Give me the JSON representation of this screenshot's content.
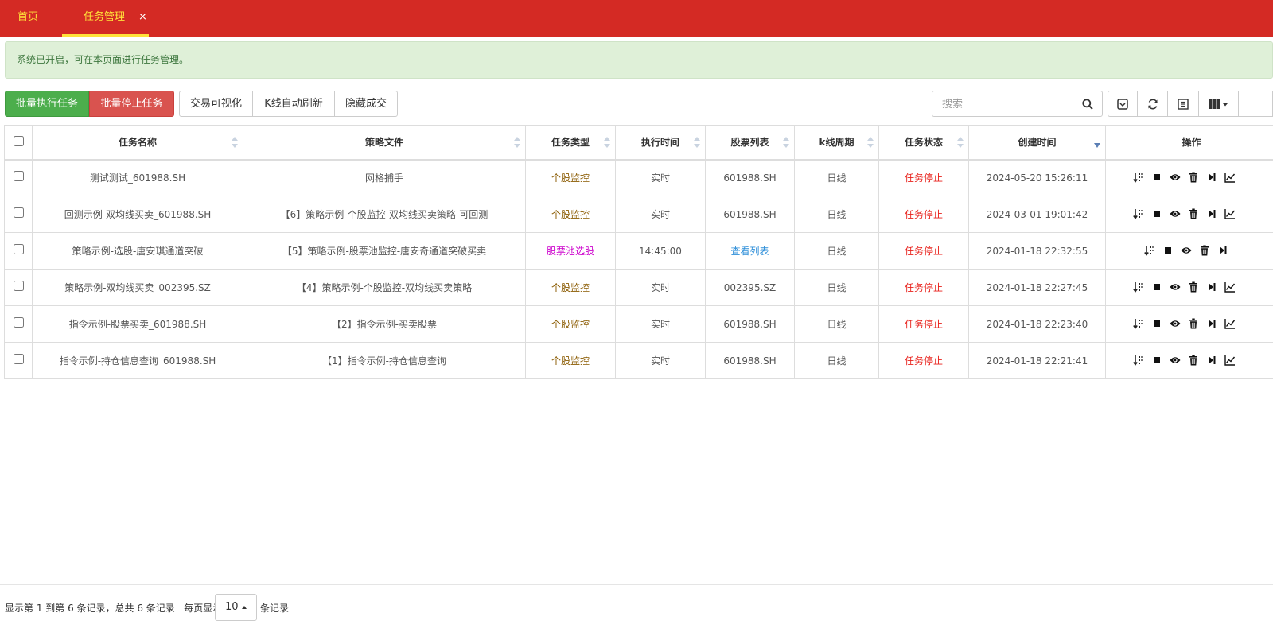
{
  "tabs": {
    "home": "首页",
    "active": "任务管理",
    "close": "×"
  },
  "alert": "系统已开启，可在本页面进行任务管理。",
  "toolbar": {
    "batch_run": "批量执行任务",
    "batch_stop": "批量停止任务",
    "trade_visual": "交易可视化",
    "kline_refresh": "K线自动刷新",
    "hide_deals": "隐藏成交",
    "search_placeholder": "搜索"
  },
  "table": {
    "headers": [
      "任务名称",
      "策略文件",
      "任务类型",
      "执行时间",
      "股票列表",
      "k线周期",
      "任务状态",
      "创建时间",
      "操作"
    ],
    "rows": [
      {
        "name": "测试测试_601988.SH",
        "strategy": "网格捕手",
        "type": "个股监控",
        "time": "实时",
        "stocks": "601988.SH",
        "period": "日线",
        "status": "任务停止",
        "created": "2024-05-20 15:26:11"
      },
      {
        "name": "回测示例-双均线买卖_601988.SH",
        "strategy": "【6】策略示例-个股监控-双均线买卖策略-可回测",
        "type": "个股监控",
        "time": "实时",
        "stocks": "601988.SH",
        "period": "日线",
        "status": "任务停止",
        "created": "2024-03-01 19:01:42"
      },
      {
        "name": "策略示例-选股-唐安琪通道突破",
        "strategy": "【5】策略示例-股票池监控-唐安奇通道突破买卖",
        "type": "股票池选股",
        "time": "14:45:00",
        "stocks": "查看列表",
        "period": "日线",
        "status": "任务停止",
        "created": "2024-01-18 22:32:55"
      },
      {
        "name": "策略示例-双均线买卖_002395.SZ",
        "strategy": "【4】策略示例-个股监控-双均线买卖策略",
        "type": "个股监控",
        "time": "实时",
        "stocks": "002395.SZ",
        "period": "日线",
        "status": "任务停止",
        "created": "2024-01-18 22:27:45"
      },
      {
        "name": "指令示例-股票买卖_601988.SH",
        "strategy": "【2】指令示例-买卖股票",
        "type": "个股监控",
        "time": "实时",
        "stocks": "601988.SH",
        "period": "日线",
        "status": "任务停止",
        "created": "2024-01-18 22:23:40"
      },
      {
        "name": "指令示例-持仓信息查询_601988.SH",
        "strategy": "【1】指令示例-持仓信息查询",
        "type": "个股监控",
        "time": "实时",
        "stocks": "601988.SH",
        "period": "日线",
        "status": "任务停止",
        "created": "2024-01-18 22:21:41"
      }
    ]
  },
  "footer": {
    "summary": "显示第 1 到第 6 条记录，总共 6 条记录",
    "per_page_label": "每页显示",
    "page_size": "10",
    "records_label": "条记录"
  },
  "colors": {
    "topbar": "#d42a24",
    "tab_text": "#ffe23a",
    "alert_bg": "#dff0d8",
    "green": "#4cae4c",
    "red": "#d9534f",
    "status_stopped": "#e8221c"
  }
}
